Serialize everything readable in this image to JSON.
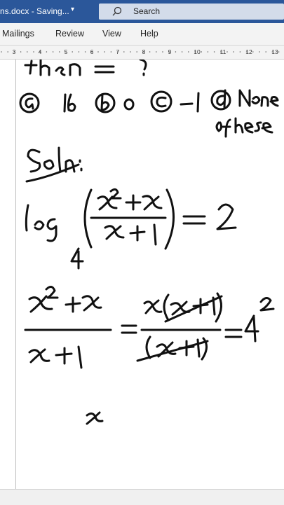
{
  "titlebar": {
    "doc_name": "ns.docx  -  Saving...",
    "search_label": "Search"
  },
  "ribbon": {
    "tabs": [
      "Mailings",
      "Review",
      "View",
      "Help"
    ]
  },
  "ruler": {
    "numbers": [
      "3",
      "4",
      "5",
      "6",
      "7",
      "8",
      "9",
      "10",
      "11",
      "12",
      "13"
    ]
  },
  "handwriting": {
    "options": [
      "a",
      "16",
      "b",
      "0",
      "c",
      "-1",
      "d",
      "None",
      "of these"
    ],
    "soln_label": "Soln:",
    "log_base": "4",
    "equals_value": "2",
    "exponent": "2",
    "last_var": "x"
  }
}
